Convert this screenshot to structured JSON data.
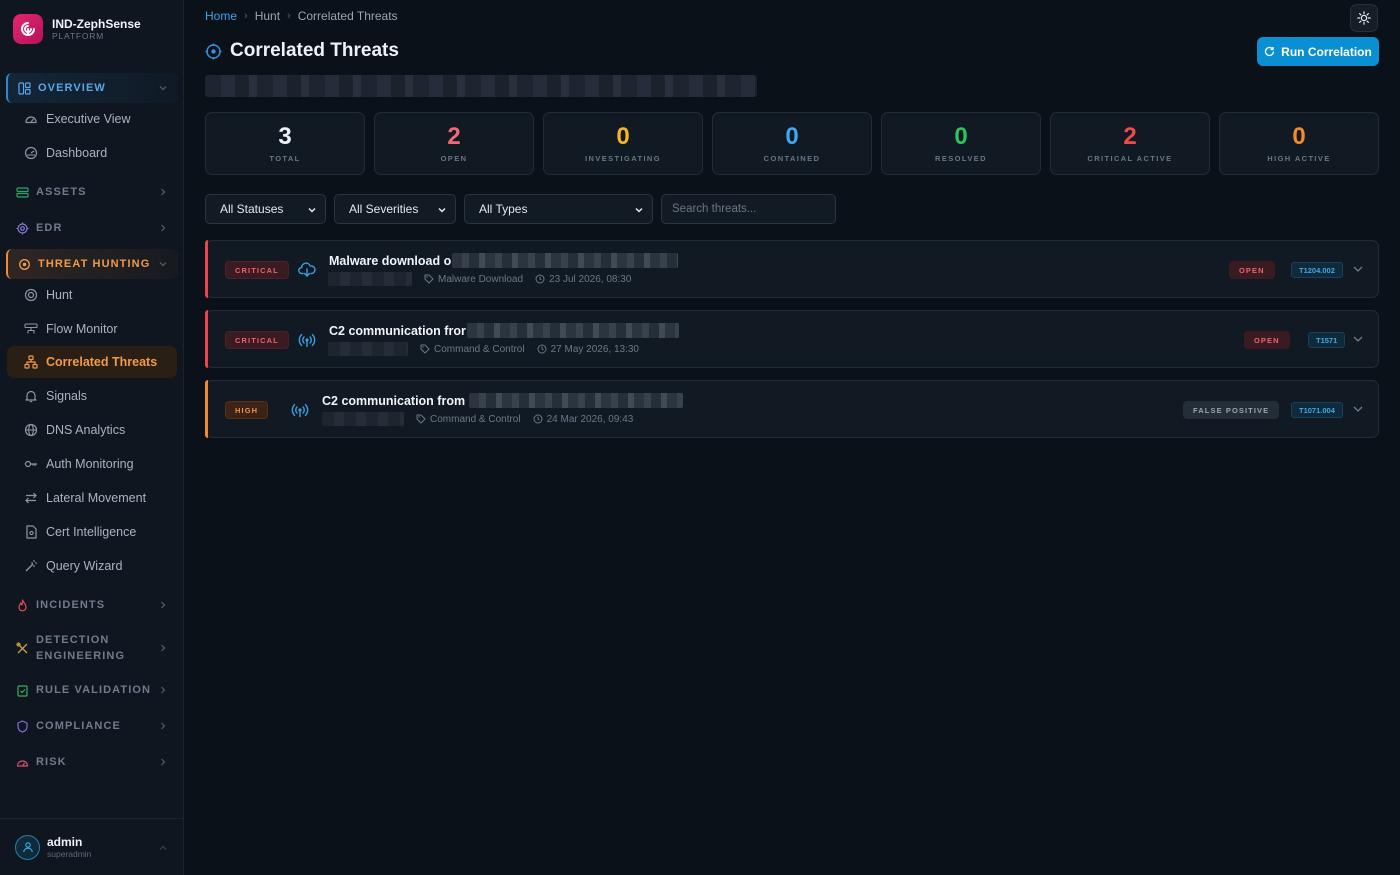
{
  "brand": {
    "name": "IND-ZephSense",
    "subtitle": "PLATFORM"
  },
  "sidebar": {
    "overview": {
      "label": "OVERVIEW",
      "items": [
        {
          "label": "Executive View"
        },
        {
          "label": "Dashboard"
        }
      ]
    },
    "assets": {
      "label": "ASSETS"
    },
    "edr": {
      "label": "EDR"
    },
    "threat_hunting": {
      "label": "THREAT HUNTING",
      "items": [
        {
          "label": "Hunt"
        },
        {
          "label": "Flow Monitor"
        },
        {
          "label": "Correlated Threats"
        },
        {
          "label": "Signals"
        },
        {
          "label": "DNS Analytics"
        },
        {
          "label": "Auth Monitoring"
        },
        {
          "label": "Lateral Movement"
        },
        {
          "label": "Cert Intelligence"
        },
        {
          "label": "Query Wizard"
        }
      ]
    },
    "incidents": {
      "label": "INCIDENTS"
    },
    "detection": {
      "label1": "DETECTION",
      "label2": "ENGINEERING"
    },
    "rule_validation": {
      "label": "RULE VALIDATION"
    },
    "compliance": {
      "label": "COMPLIANCE"
    },
    "risk": {
      "label": "RISK"
    }
  },
  "user": {
    "name": "admin",
    "role": "superadmin"
  },
  "breadcrumb": {
    "home": "Home",
    "hunt": "Hunt",
    "current": "Correlated Threats"
  },
  "page": {
    "title": "Correlated Threats",
    "run_button": "Run Correlation"
  },
  "stats": [
    {
      "value": "3",
      "label": "TOTAL",
      "color": "#eef2f7"
    },
    {
      "value": "2",
      "label": "OPEN",
      "color": "#f2687a"
    },
    {
      "value": "0",
      "label": "INVESTIGATING",
      "color": "#f5b526"
    },
    {
      "value": "0",
      "label": "CONTAINED",
      "color": "#3fa8ee"
    },
    {
      "value": "0",
      "label": "RESOLVED",
      "color": "#2fc25b"
    },
    {
      "value": "2",
      "label": "CRITICAL ACTIVE",
      "color": "#f04a4a"
    },
    {
      "value": "0",
      "label": "HIGH ACTIVE",
      "color": "#f28a2e"
    }
  ],
  "filters": {
    "status": "All Statuses",
    "severity": "All Severities",
    "type": "All Types",
    "search_placeholder": "Search threats..."
  },
  "threats": [
    {
      "severity": "CRITICAL",
      "title": "Malware download o",
      "category": "Malware Download",
      "time": "23 Jul 2026, 08:30",
      "status": "OPEN",
      "mitre": "T1204.002"
    },
    {
      "severity": "CRITICAL",
      "title": "C2 communication fror",
      "category": "Command & Control",
      "time": "27 May 2026, 13:30",
      "status": "OPEN",
      "mitre": "T1571"
    },
    {
      "severity": "HIGH",
      "title": "C2 communication from",
      "category": "Command & Control",
      "time": "24 Mar 2026, 09:43",
      "status": "FALSE POSITIVE",
      "mitre": "T1071.004"
    }
  ],
  "colors": {
    "accent": "#0b8fd3",
    "critical": "#f04a4a",
    "high": "#f28a2e",
    "active_nav": "#f2994a"
  }
}
